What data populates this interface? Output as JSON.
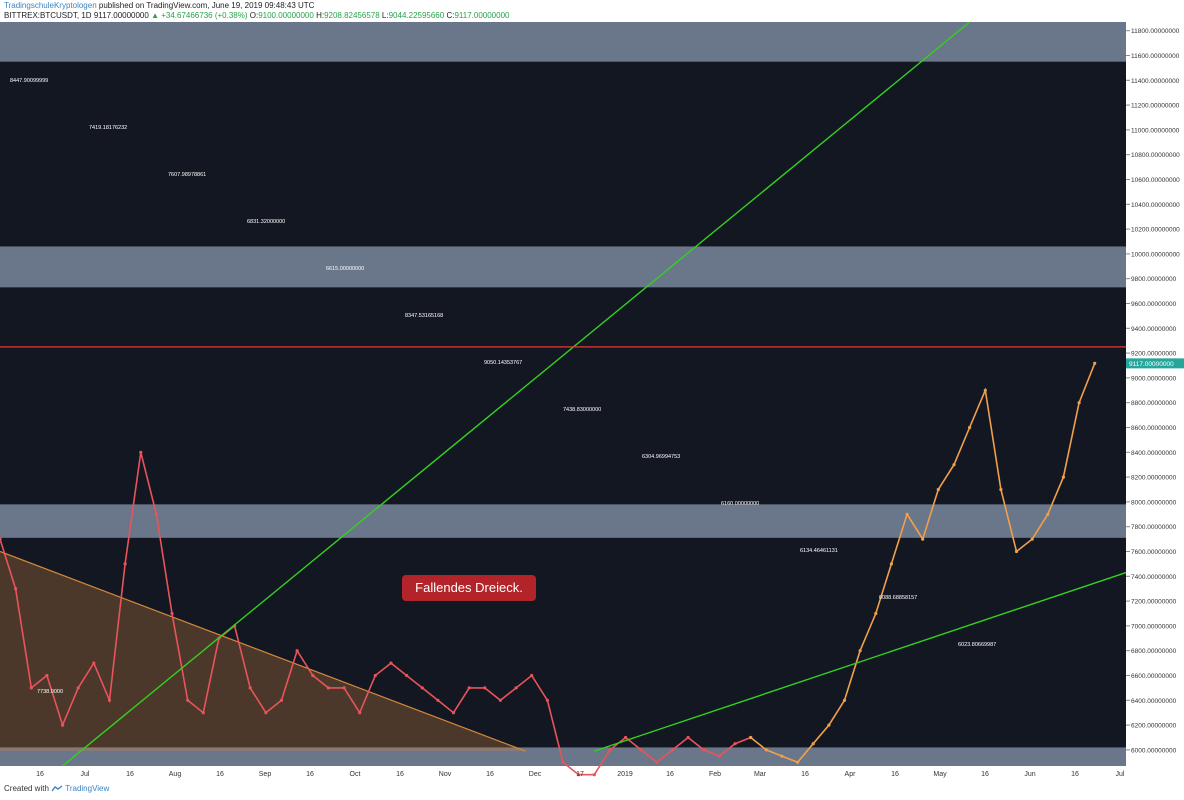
{
  "header": {
    "author": "TradingschuleKryptologen",
    "published": "published on TradingView.com, June 19, 2019 09:48:43 UTC",
    "symbol": "BITTREX:BTCUSDT, 1D",
    "last": "9117.00000000",
    "change": "▲ +34.67466736 (+0.38%)",
    "o_label": "O:",
    "o_value": "9100.00000000",
    "h_label": "H:",
    "h_value": "9208.82456578",
    "l_label": "L:",
    "l_value": "9044.22595660",
    "c_label": "C:",
    "c_value": "9117.00000000"
  },
  "footer": {
    "created": "Created with",
    "brand": "TradingView"
  },
  "chart_data": {
    "type": "line",
    "title": "",
    "price_axis": {
      "ticks": [
        "11800.00000000",
        "11600.00000000",
        "11400.00000000",
        "11200.00000000",
        "11000.00000000",
        "10800.00000000",
        "10600.00000000",
        "10400.00000000",
        "10200.00000000",
        "10000.00000000",
        "9800.00000000",
        "9600.00000000",
        "9400.00000000",
        "9200.00000000",
        "9000.00000000",
        "8800.00000000",
        "8600.00000000",
        "8400.00000000",
        "8200.00000000",
        "8000.00000000",
        "7800.00000000",
        "7600.00000000",
        "7400.00000000",
        "7200.00000000",
        "7000.00000000",
        "6800.00000000",
        "6600.00000000",
        "6400.00000000",
        "6200.00000000",
        "6000.00000000"
      ],
      "min": 5870,
      "max": 11870,
      "last_price_label": "9117.00000000",
      "last_price": 9117
    },
    "time_axis": {
      "labels": [
        "16",
        "Jul",
        "16",
        "Aug",
        "16",
        "Sep",
        "16",
        "Oct",
        "16",
        "Nov",
        "16",
        "Dec",
        "17",
        "2019",
        "16",
        "Feb",
        "Mar",
        "16",
        "Apr",
        "16",
        "May",
        "16",
        "Jun",
        "16",
        "Jul"
      ]
    },
    "series": [
      {
        "x": [
          0,
          5,
          10,
          15,
          20,
          25,
          30,
          35,
          40,
          45,
          50,
          55,
          60,
          65,
          70,
          75,
          80,
          85,
          90,
          95,
          100,
          105,
          110,
          115,
          120,
          125,
          130,
          135,
          140,
          145,
          150,
          155,
          160,
          165,
          170,
          175,
          180,
          185,
          190,
          195,
          200,
          205,
          210,
          215,
          220,
          225,
          230,
          235,
          240
        ],
        "values": [
          7700,
          7300,
          6500,
          6600,
          6200,
          6500,
          6700,
          6400,
          7500,
          8400,
          7900,
          7100,
          6400,
          6300,
          6900,
          7000,
          6500,
          6300,
          6400,
          6800,
          6600,
          6500,
          6500,
          6300,
          6600,
          6700,
          6600,
          6500,
          6400,
          6300,
          6500,
          6500,
          6400,
          6500,
          6600,
          6400,
          5900,
          5800,
          5800,
          6000,
          6100,
          6000,
          5900,
          6000,
          6100,
          6000,
          5950,
          6050,
          6100
        ]
      },
      {
        "x": [
          240,
          245,
          250,
          255,
          260,
          265,
          270,
          275,
          280,
          285,
          290,
          295,
          300,
          305,
          310,
          315,
          320,
          325,
          330,
          335,
          340,
          345,
          350
        ],
        "values": [
          6100,
          6000,
          5950,
          5900,
          6050,
          6200,
          6400,
          6800,
          7100,
          7500,
          7900,
          7700,
          8100,
          8300,
          8600,
          8900,
          8100,
          7600,
          7700,
          7900,
          8200,
          8800,
          9117
        ]
      }
    ],
    "annotations": {
      "zone_labels": [
        "8447.90099999",
        "7419.18176232",
        "7607.98978861",
        "6831.32000000",
        "6615.00000000",
        "8347.53165168",
        "9050.14353767",
        "7438.83000000",
        "6304.96994753",
        "6160.00000000",
        "6134.46461131",
        "6088.68858157",
        "6023.80669987",
        "7738.0000"
      ],
      "callout": "Fallendes Dreieck."
    },
    "resistance_price": 9250,
    "zones_price": [
      [
        11550,
        11870
      ],
      [
        9730,
        10060
      ],
      [
        7710,
        7980
      ],
      [
        5870,
        6020
      ]
    ],
    "grid": false
  }
}
